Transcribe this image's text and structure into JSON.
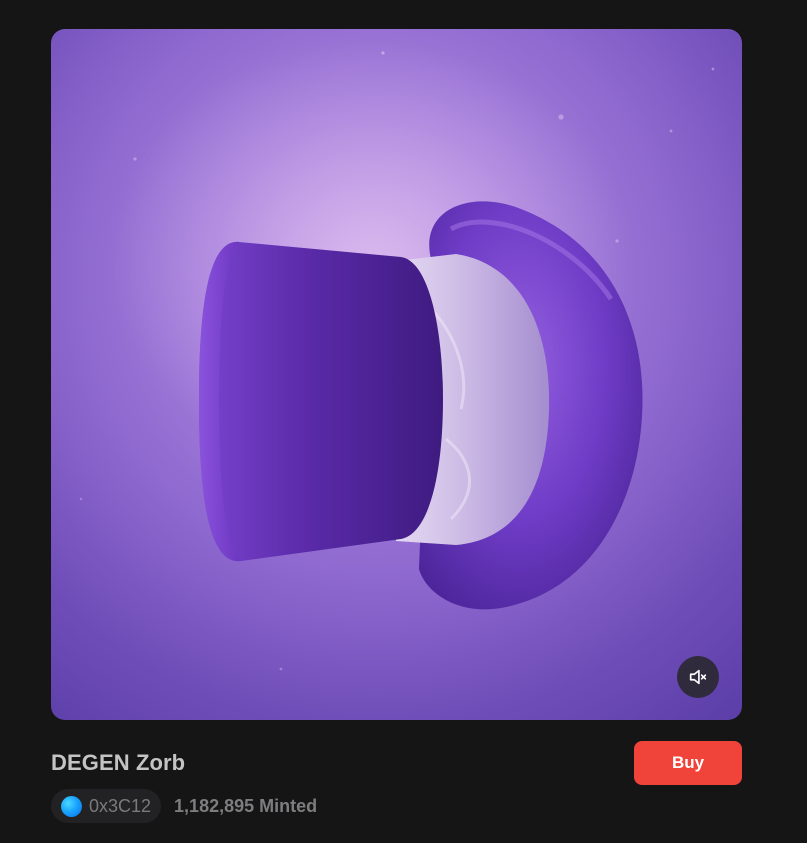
{
  "nft": {
    "title": "DEGEN Zorb",
    "buy_label": "Buy",
    "creator_address": "0x3C12",
    "minted_count": "1,182,895",
    "minted_label": "Minted"
  },
  "media": {
    "mute_icon": "speaker-muted-icon",
    "artwork": "purple-top-hat"
  },
  "colors": {
    "page_background": "#151515",
    "buy_button": "#f0433a",
    "hat_purple": "#6a38c2",
    "hat_band": "#cdbde3",
    "media_background": "#9a74d6"
  }
}
